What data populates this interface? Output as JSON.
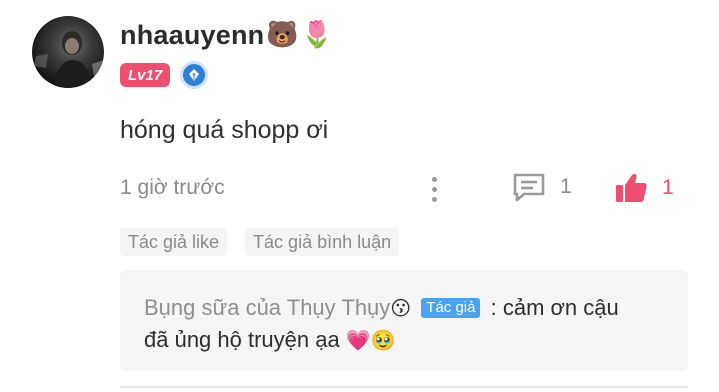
{
  "user": {
    "name": "nhaauyenn",
    "name_emojis": [
      "🐻",
      "🌷"
    ],
    "level": "Lv17"
  },
  "comment": {
    "text": "hóng quá shopp ơi",
    "timestamp": "1 giờ trước",
    "reply_count": "1",
    "like_count": "1"
  },
  "tags": [
    "Tác giả like",
    "Tác giả bình luận"
  ],
  "reply": {
    "author": "Bụng sữa của Thụy Thụy",
    "author_emoji": "😗",
    "badge": "Tác giả",
    "text_line1": ": cảm ơn cậu",
    "text_line2": "đã ủng hộ truyện ạa",
    "end_emojis": [
      "💗",
      "🥹"
    ]
  },
  "colors": {
    "accent": "#ef4f6e",
    "author_badge": "#4aa3f0",
    "muted": "#8a8a8a"
  },
  "icons": {
    "avatar": "user-avatar-photo",
    "writer_badge": "fountain-pen-icon",
    "more": "more-vertical-icon",
    "reply": "comment-icon",
    "like": "thumbs-up-icon"
  }
}
